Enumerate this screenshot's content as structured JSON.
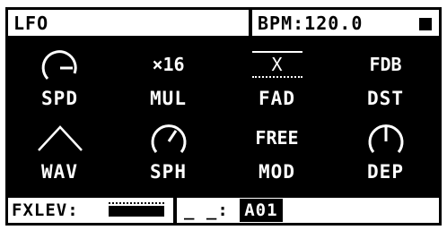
{
  "header": {
    "title": "LFO",
    "bpm": "BPM:120.0",
    "status_icon": "stop-square-icon"
  },
  "params": [
    {
      "label": "SPD",
      "icon": "speed-knob-icon"
    },
    {
      "label": "MUL",
      "value": "×16"
    },
    {
      "label": "FAD",
      "value": "X"
    },
    {
      "label": "DST",
      "value": "FDB"
    },
    {
      "label": "WAV",
      "icon": "triangle-wave-icon"
    },
    {
      "label": "SPH",
      "icon": "start-phase-knob-icon"
    },
    {
      "label": "MOD",
      "value": "FREE"
    },
    {
      "label": "DEP",
      "icon": "depth-knob-icon"
    }
  ],
  "footer": {
    "fx_label": "FXLEV:",
    "slot_prefix": "_ _:",
    "slot_value": "A01"
  },
  "colors": {
    "background": "#000000",
    "foreground": "#ffffff"
  }
}
